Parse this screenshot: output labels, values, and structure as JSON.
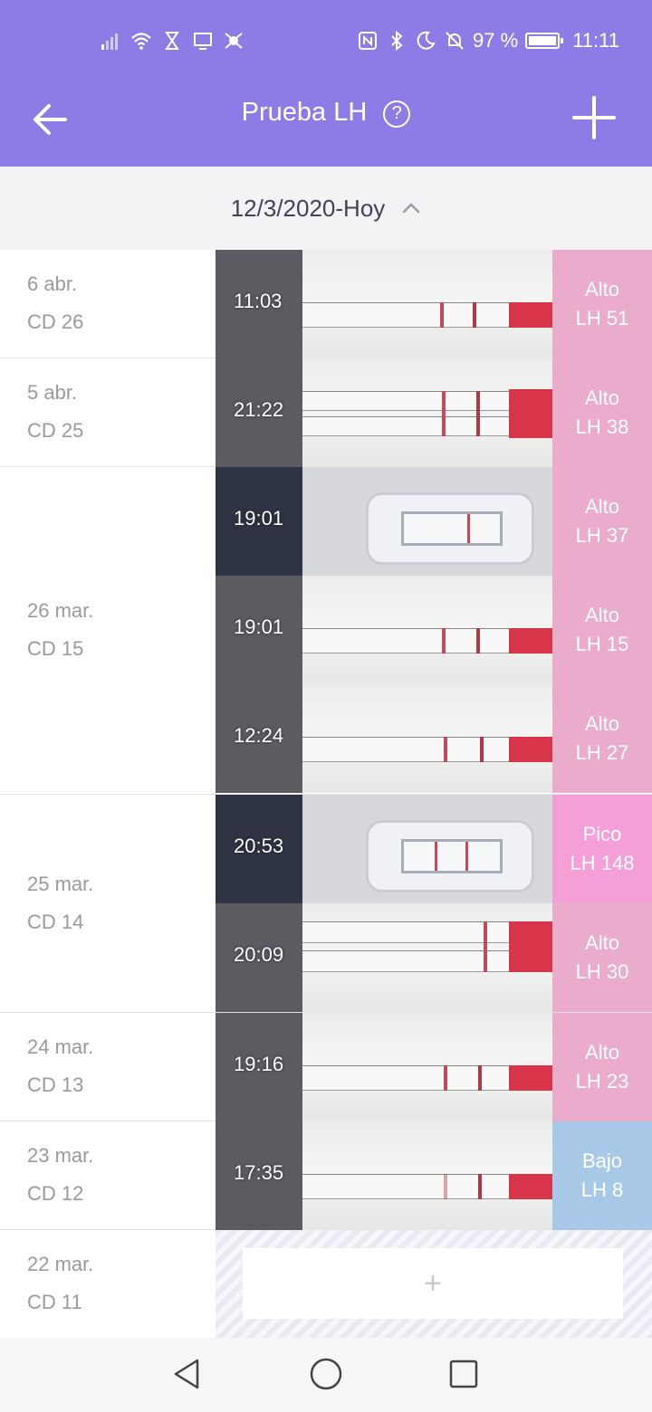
{
  "status": {
    "battery": "97 %",
    "time": "11:11"
  },
  "header": {
    "title": "Prueba LH",
    "help": "?"
  },
  "date_range": "12/3/2020-Hoy",
  "days": [
    {
      "date": "6 abr.",
      "cycle_day": "CD 26",
      "entries": [
        {
          "time": "11:03",
          "level": "Alto",
          "value": "LH 51"
        }
      ]
    },
    {
      "date": "5 abr.",
      "cycle_day": "CD 25",
      "entries": [
        {
          "time": "21:22",
          "level": "Alto",
          "value": "LH 38"
        }
      ]
    },
    {
      "date": "26 mar.",
      "cycle_day": "CD 15",
      "entries": [
        {
          "time": "19:01",
          "level": "Alto",
          "value": "LH 37"
        },
        {
          "time": "19:01",
          "level": "Alto",
          "value": "LH 15"
        },
        {
          "time": "12:24",
          "level": "Alto",
          "value": "LH 27"
        }
      ]
    },
    {
      "date": "25 mar.",
      "cycle_day": "CD 14",
      "entries": [
        {
          "time": "20:53",
          "level": "Pico",
          "value": "LH 148"
        },
        {
          "time": "20:09",
          "level": "Alto",
          "value": "LH 30"
        }
      ]
    },
    {
      "date": "24 mar.",
      "cycle_day": "CD 13",
      "entries": [
        {
          "time": "19:16",
          "level": "Alto",
          "value": "LH 23"
        }
      ]
    },
    {
      "date": "23 mar.",
      "cycle_day": "CD 12",
      "entries": [
        {
          "time": "17:35",
          "level": "Bajo",
          "value": "LH 8"
        }
      ]
    },
    {
      "date": "22 mar.",
      "cycle_day": "CD 11",
      "add_label": "+"
    }
  ],
  "colors": {
    "header": "#8d7be6",
    "high": "#e8a4c8",
    "peak": "#f59fd8",
    "low": "#a8c8e8"
  }
}
